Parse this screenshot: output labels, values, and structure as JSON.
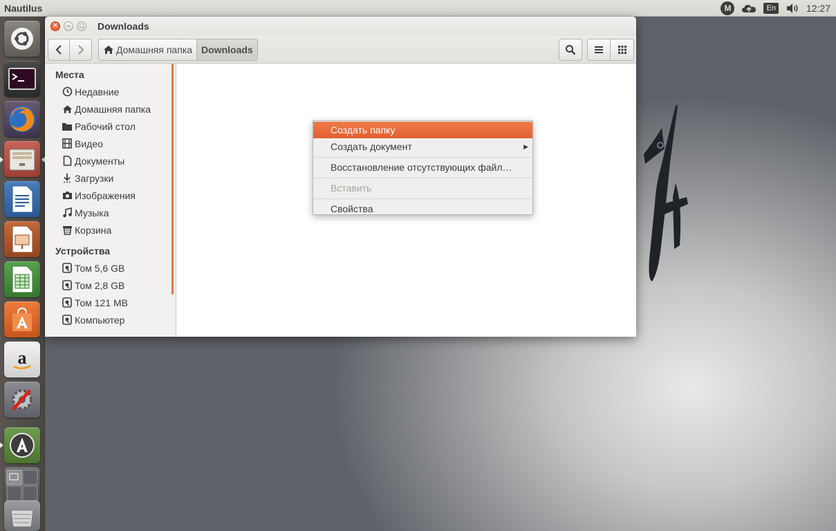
{
  "panel": {
    "app_name": "Nautilus",
    "mail_badge": "M",
    "keyboard_layout": "En",
    "clock": "12:27"
  },
  "window": {
    "title": "Downloads",
    "toolbar": {
      "breadcrumbs": [
        "Домашняя папка",
        "Downloads"
      ]
    }
  },
  "sidebar": {
    "places_heading": "Места",
    "places": [
      {
        "label": "Недавние",
        "icon": "clock-icon"
      },
      {
        "label": "Домашняя папка",
        "icon": "home-icon"
      },
      {
        "label": "Рабочий стол",
        "icon": "folder-icon"
      },
      {
        "label": "Видео",
        "icon": "film-icon"
      },
      {
        "label": "Документы",
        "icon": "document-icon"
      },
      {
        "label": "Загрузки",
        "icon": "download-icon"
      },
      {
        "label": "Изображения",
        "icon": "camera-icon"
      },
      {
        "label": "Музыка",
        "icon": "music-icon"
      },
      {
        "label": "Корзина",
        "icon": "trash-icon"
      }
    ],
    "devices_heading": "Устройства",
    "devices": [
      {
        "label": "Том 5,6 GB",
        "icon": "drive-icon"
      },
      {
        "label": "Том 2,8 GB",
        "icon": "drive-icon"
      },
      {
        "label": "Том 121 MB",
        "icon": "drive-icon"
      },
      {
        "label": "Компьютер",
        "icon": "drive-icon"
      }
    ]
  },
  "context_menu": {
    "items": [
      {
        "label": "Создать папку",
        "state": "highlighted"
      },
      {
        "label": "Создать документ",
        "state": "normal",
        "submenu": true
      },
      {
        "label": "Восстановление отсутствующих файл…",
        "state": "normal"
      },
      {
        "label": "Вставить",
        "state": "disabled"
      },
      {
        "label": "Свойства",
        "state": "normal"
      }
    ]
  },
  "launcher": {
    "apps": [
      {
        "name": "dash-home",
        "icon": "ubuntu-logo-icon"
      },
      {
        "name": "terminal",
        "icon": "terminal-icon"
      },
      {
        "name": "firefox",
        "icon": "firefox-icon"
      },
      {
        "name": "files",
        "icon": "files-icon",
        "active": true
      },
      {
        "name": "writer",
        "icon": "writer-icon"
      },
      {
        "name": "impress",
        "icon": "impress-icon"
      },
      {
        "name": "calc",
        "icon": "calc-icon"
      },
      {
        "name": "software-center",
        "icon": "software-center-icon"
      },
      {
        "name": "amazon",
        "icon": "amazon-icon"
      },
      {
        "name": "system-settings",
        "icon": "settings-icon"
      },
      {
        "name": "software-updater",
        "icon": "updater-icon",
        "active": true
      },
      {
        "name": "workspaces",
        "icon": "workspace-switcher-icon"
      },
      {
        "name": "trash",
        "icon": "trash-icon"
      }
    ]
  },
  "colors": {
    "accent": "#e0602f",
    "panel_bg": "#dfded9",
    "launcher_bg": "#524e49",
    "window_bg": "#f2f1f0"
  }
}
